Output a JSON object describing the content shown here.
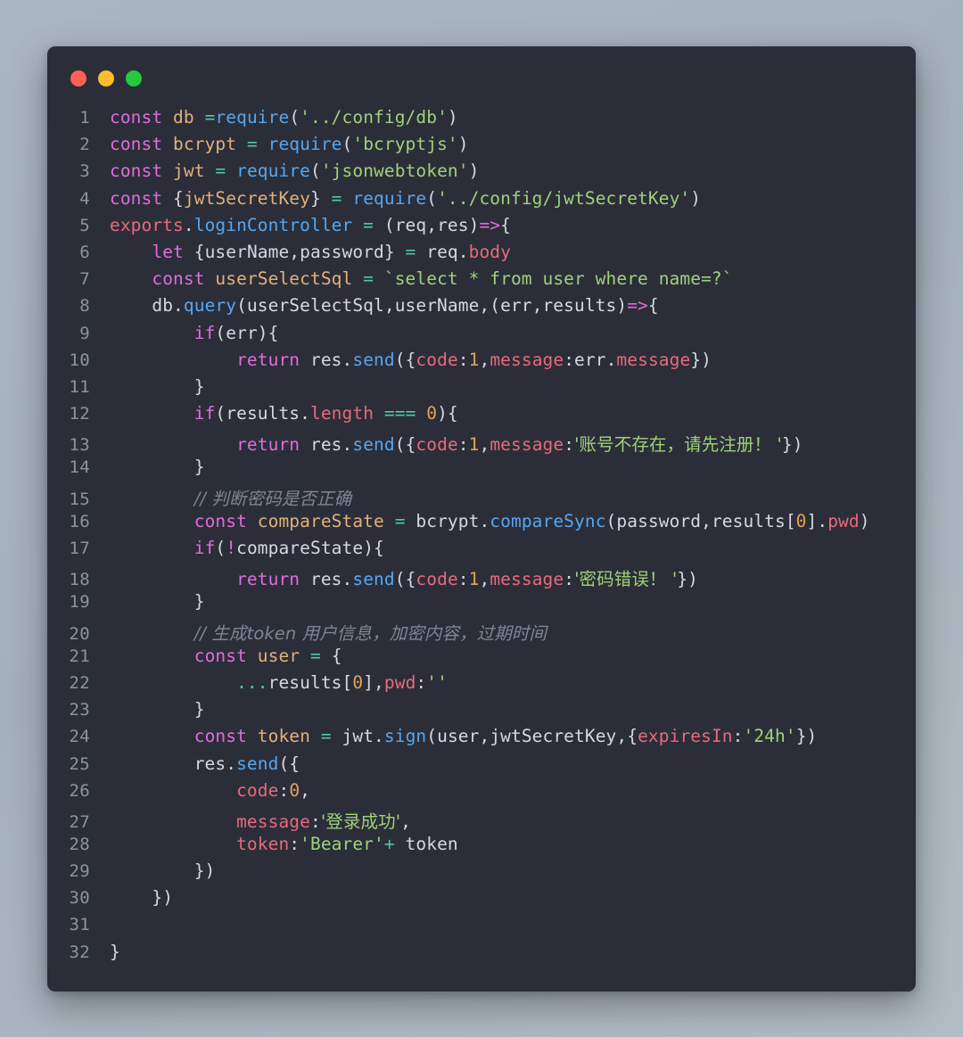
{
  "window": {
    "controls": [
      {
        "name": "close",
        "color": "#ff5f56"
      },
      {
        "name": "minimize",
        "color": "#ffbd2e"
      },
      {
        "name": "maximize",
        "color": "#27c93f"
      }
    ],
    "background_color": "#2b2e38",
    "page_background_color": "#a8b4bf"
  },
  "editor": {
    "language": "javascript",
    "first_line_number": 1,
    "last_line_number": 32,
    "theme_colors": {
      "keyword": "#e06cdc",
      "function": "#57a6f0",
      "variable": "#e2b07a",
      "string": "#9fd17a",
      "number": "#e2a355",
      "operator": "#4ec9b0",
      "property": "#e86a7c",
      "plain": "#d5d8de",
      "comment": "#7f8595",
      "line_number": "#8d93a3"
    },
    "lines": [
      {
        "n": "1",
        "text": "const db =require('../config/db')"
      },
      {
        "n": "2",
        "text": "const bcrypt = require('bcryptjs')"
      },
      {
        "n": "3",
        "text": "const jwt = require('jsonwebtoken')"
      },
      {
        "n": "4",
        "text": "const {jwtSecretKey} = require('../config/jwtSecretKey')"
      },
      {
        "n": "5",
        "text": "exports.loginController = (req,res)=>{"
      },
      {
        "n": "6",
        "text": "    let {userName,password} = req.body"
      },
      {
        "n": "7",
        "text": "    const userSelectSql = `select * from user where name=?`"
      },
      {
        "n": "8",
        "text": "    db.query(userSelectSql,userName,(err,results)=>{"
      },
      {
        "n": "9",
        "text": "        if(err){"
      },
      {
        "n": "10",
        "text": "            return res.send({code:1,message:err.message})"
      },
      {
        "n": "11",
        "text": "        }"
      },
      {
        "n": "12",
        "text": "        if(results.length === 0){"
      },
      {
        "n": "13",
        "text": "            return res.send({code:1,message:'账号不存在，请先注册！ '})"
      },
      {
        "n": "14",
        "text": "        }"
      },
      {
        "n": "15",
        "text": "        // 判断密码是否正确"
      },
      {
        "n": "16",
        "text": "        const compareState = bcrypt.compareSync(password,results[0].pwd)"
      },
      {
        "n": "17",
        "text": "        if(!compareState){"
      },
      {
        "n": "18",
        "text": "            return res.send({code:1,message:'密码错误！ '})"
      },
      {
        "n": "19",
        "text": "        }"
      },
      {
        "n": "20",
        "text": "        // 生成token 用户信息，加密内容，过期时间"
      },
      {
        "n": "21",
        "text": "        const user = {"
      },
      {
        "n": "22",
        "text": "            ...results[0],pwd:''"
      },
      {
        "n": "23",
        "text": "        }"
      },
      {
        "n": "24",
        "text": "        const token = jwt.sign(user,jwtSecretKey,{expiresIn:'24h'})"
      },
      {
        "n": "25",
        "text": "        res.send({"
      },
      {
        "n": "26",
        "text": "            code:0,"
      },
      {
        "n": "27",
        "text": "            message:'登录成功',"
      },
      {
        "n": "28",
        "text": "            token:'Bearer'+ token"
      },
      {
        "n": "29",
        "text": "        })"
      },
      {
        "n": "30",
        "text": "    })"
      },
      {
        "n": "31",
        "text": ""
      },
      {
        "n": "32",
        "text": "}"
      }
    ],
    "tokens": [
      [
        {
          "t": "const",
          "c": "kw"
        },
        {
          "t": " ",
          "c": "plain"
        },
        {
          "t": "db",
          "c": "var"
        },
        {
          "t": " =",
          "c": "op"
        },
        {
          "t": "require",
          "c": "fn"
        },
        {
          "t": "(",
          "c": "plain"
        },
        {
          "t": "'../config/db'",
          "c": "str"
        },
        {
          "t": ")",
          "c": "plain"
        }
      ],
      [
        {
          "t": "const",
          "c": "kw"
        },
        {
          "t": " ",
          "c": "plain"
        },
        {
          "t": "bcrypt",
          "c": "var"
        },
        {
          "t": " = ",
          "c": "op"
        },
        {
          "t": "require",
          "c": "fn"
        },
        {
          "t": "(",
          "c": "plain"
        },
        {
          "t": "'bcryptjs'",
          "c": "str"
        },
        {
          "t": ")",
          "c": "plain"
        }
      ],
      [
        {
          "t": "const",
          "c": "kw"
        },
        {
          "t": " ",
          "c": "plain"
        },
        {
          "t": "jwt",
          "c": "var"
        },
        {
          "t": " = ",
          "c": "op"
        },
        {
          "t": "require",
          "c": "fn"
        },
        {
          "t": "(",
          "c": "plain"
        },
        {
          "t": "'jsonwebtoken'",
          "c": "str"
        },
        {
          "t": ")",
          "c": "plain"
        }
      ],
      [
        {
          "t": "const",
          "c": "kw"
        },
        {
          "t": " {",
          "c": "plain"
        },
        {
          "t": "jwtSecretKey",
          "c": "var"
        },
        {
          "t": "} ",
          "c": "plain"
        },
        {
          "t": "= ",
          "c": "op"
        },
        {
          "t": "require",
          "c": "fn"
        },
        {
          "t": "(",
          "c": "plain"
        },
        {
          "t": "'../config/jwtSecretKey'",
          "c": "str"
        },
        {
          "t": ")",
          "c": "plain"
        }
      ],
      [
        {
          "t": "exports",
          "c": "prop"
        },
        {
          "t": ".",
          "c": "plain"
        },
        {
          "t": "loginController",
          "c": "fn"
        },
        {
          "t": " = ",
          "c": "op"
        },
        {
          "t": "(req,res)",
          "c": "plain"
        },
        {
          "t": "=>",
          "c": "kw"
        },
        {
          "t": "{",
          "c": "plain"
        }
      ],
      [
        {
          "t": "    ",
          "c": "plain"
        },
        {
          "t": "let",
          "c": "kw"
        },
        {
          "t": " {userName,password} ",
          "c": "plain"
        },
        {
          "t": "= ",
          "c": "op"
        },
        {
          "t": "req",
          "c": "plain"
        },
        {
          "t": ".",
          "c": "plain"
        },
        {
          "t": "body",
          "c": "prop"
        }
      ],
      [
        {
          "t": "    ",
          "c": "plain"
        },
        {
          "t": "const",
          "c": "kw"
        },
        {
          "t": " ",
          "c": "plain"
        },
        {
          "t": "userSelectSql",
          "c": "var"
        },
        {
          "t": " = ",
          "c": "op"
        },
        {
          "t": "`select * from user where name=?`",
          "c": "str"
        }
      ],
      [
        {
          "t": "    db",
          "c": "plain"
        },
        {
          "t": ".",
          "c": "plain"
        },
        {
          "t": "query",
          "c": "fn"
        },
        {
          "t": "(userSelectSql,userName,(err,results)",
          "c": "plain"
        },
        {
          "t": "=>",
          "c": "kw"
        },
        {
          "t": "{",
          "c": "plain"
        }
      ],
      [
        {
          "t": "        ",
          "c": "plain"
        },
        {
          "t": "if",
          "c": "kw"
        },
        {
          "t": "(err){",
          "c": "plain"
        }
      ],
      [
        {
          "t": "            ",
          "c": "plain"
        },
        {
          "t": "return",
          "c": "kw"
        },
        {
          "t": " res",
          "c": "plain"
        },
        {
          "t": ".",
          "c": "plain"
        },
        {
          "t": "send",
          "c": "fn"
        },
        {
          "t": "({",
          "c": "plain"
        },
        {
          "t": "code",
          "c": "prop"
        },
        {
          "t": ":",
          "c": "plain"
        },
        {
          "t": "1",
          "c": "num"
        },
        {
          "t": ",",
          "c": "plain"
        },
        {
          "t": "message",
          "c": "prop"
        },
        {
          "t": ":err.",
          "c": "plain"
        },
        {
          "t": "message",
          "c": "prop"
        },
        {
          "t": "})",
          "c": "plain"
        }
      ],
      [
        {
          "t": "        }",
          "c": "plain"
        }
      ],
      [
        {
          "t": "        ",
          "c": "plain"
        },
        {
          "t": "if",
          "c": "kw"
        },
        {
          "t": "(results",
          "c": "plain"
        },
        {
          "t": ".",
          "c": "plain"
        },
        {
          "t": "length",
          "c": "prop"
        },
        {
          "t": " === ",
          "c": "op"
        },
        {
          "t": "0",
          "c": "num"
        },
        {
          "t": "){",
          "c": "plain"
        }
      ],
      [
        {
          "t": "            ",
          "c": "plain"
        },
        {
          "t": "return",
          "c": "kw"
        },
        {
          "t": " res",
          "c": "plain"
        },
        {
          "t": ".",
          "c": "plain"
        },
        {
          "t": "send",
          "c": "fn"
        },
        {
          "t": "({",
          "c": "plain"
        },
        {
          "t": "code",
          "c": "prop"
        },
        {
          "t": ":",
          "c": "plain"
        },
        {
          "t": "1",
          "c": "num"
        },
        {
          "t": ",",
          "c": "plain"
        },
        {
          "t": "message",
          "c": "prop"
        },
        {
          "t": ":",
          "c": "plain"
        },
        {
          "t": "'账号不存在，请先注册！ '",
          "c": "str"
        },
        {
          "t": "})",
          "c": "plain"
        }
      ],
      [
        {
          "t": "        }",
          "c": "plain"
        }
      ],
      [
        {
          "t": "        ",
          "c": "plain"
        },
        {
          "t": "// 判断密码是否正确",
          "c": "comment"
        }
      ],
      [
        {
          "t": "        ",
          "c": "plain"
        },
        {
          "t": "const",
          "c": "kw"
        },
        {
          "t": " ",
          "c": "plain"
        },
        {
          "t": "compareState",
          "c": "var"
        },
        {
          "t": " = ",
          "c": "op"
        },
        {
          "t": "bcrypt",
          "c": "plain"
        },
        {
          "t": ".",
          "c": "plain"
        },
        {
          "t": "compareSync",
          "c": "fn"
        },
        {
          "t": "(password,results[",
          "c": "plain"
        },
        {
          "t": "0",
          "c": "num"
        },
        {
          "t": "].",
          "c": "plain"
        },
        {
          "t": "pwd",
          "c": "prop"
        },
        {
          "t": ")",
          "c": "plain"
        }
      ],
      [
        {
          "t": "        ",
          "c": "plain"
        },
        {
          "t": "if",
          "c": "kw"
        },
        {
          "t": "(",
          "c": "plain"
        },
        {
          "t": "!",
          "c": "kw"
        },
        {
          "t": "compareState){",
          "c": "plain"
        }
      ],
      [
        {
          "t": "            ",
          "c": "plain"
        },
        {
          "t": "return",
          "c": "kw"
        },
        {
          "t": " res",
          "c": "plain"
        },
        {
          "t": ".",
          "c": "plain"
        },
        {
          "t": "send",
          "c": "fn"
        },
        {
          "t": "({",
          "c": "plain"
        },
        {
          "t": "code",
          "c": "prop"
        },
        {
          "t": ":",
          "c": "plain"
        },
        {
          "t": "1",
          "c": "num"
        },
        {
          "t": ",",
          "c": "plain"
        },
        {
          "t": "message",
          "c": "prop"
        },
        {
          "t": ":",
          "c": "plain"
        },
        {
          "t": "'密码错误！ '",
          "c": "str"
        },
        {
          "t": "})",
          "c": "plain"
        }
      ],
      [
        {
          "t": "        }",
          "c": "plain"
        }
      ],
      [
        {
          "t": "        ",
          "c": "plain"
        },
        {
          "t": "// 生成token 用户信息，加密内容，过期时间",
          "c": "comment"
        }
      ],
      [
        {
          "t": "        ",
          "c": "plain"
        },
        {
          "t": "const",
          "c": "kw"
        },
        {
          "t": " ",
          "c": "plain"
        },
        {
          "t": "user",
          "c": "var"
        },
        {
          "t": " = ",
          "c": "op"
        },
        {
          "t": "{",
          "c": "plain"
        }
      ],
      [
        {
          "t": "            ",
          "c": "plain"
        },
        {
          "t": "...",
          "c": "op"
        },
        {
          "t": "results[",
          "c": "plain"
        },
        {
          "t": "0",
          "c": "num"
        },
        {
          "t": "],",
          "c": "plain"
        },
        {
          "t": "pwd",
          "c": "prop"
        },
        {
          "t": ":",
          "c": "plain"
        },
        {
          "t": "''",
          "c": "str"
        }
      ],
      [
        {
          "t": "        }",
          "c": "plain"
        }
      ],
      [
        {
          "t": "        ",
          "c": "plain"
        },
        {
          "t": "const",
          "c": "kw"
        },
        {
          "t": " ",
          "c": "plain"
        },
        {
          "t": "token",
          "c": "var"
        },
        {
          "t": " = ",
          "c": "op"
        },
        {
          "t": "jwt",
          "c": "plain"
        },
        {
          "t": ".",
          "c": "plain"
        },
        {
          "t": "sign",
          "c": "fn"
        },
        {
          "t": "(user,jwtSecretKey,{",
          "c": "plain"
        },
        {
          "t": "expiresIn",
          "c": "prop"
        },
        {
          "t": ":",
          "c": "plain"
        },
        {
          "t": "'24h'",
          "c": "str"
        },
        {
          "t": "})",
          "c": "plain"
        }
      ],
      [
        {
          "t": "        res",
          "c": "plain"
        },
        {
          "t": ".",
          "c": "plain"
        },
        {
          "t": "send",
          "c": "fn"
        },
        {
          "t": "({",
          "c": "plain"
        }
      ],
      [
        {
          "t": "            ",
          "c": "plain"
        },
        {
          "t": "code",
          "c": "prop"
        },
        {
          "t": ":",
          "c": "plain"
        },
        {
          "t": "0",
          "c": "num"
        },
        {
          "t": ",",
          "c": "plain"
        }
      ],
      [
        {
          "t": "            ",
          "c": "plain"
        },
        {
          "t": "message",
          "c": "prop"
        },
        {
          "t": ":",
          "c": "plain"
        },
        {
          "t": "'登录成功'",
          "c": "str"
        },
        {
          "t": ",",
          "c": "plain"
        }
      ],
      [
        {
          "t": "            ",
          "c": "plain"
        },
        {
          "t": "token",
          "c": "prop"
        },
        {
          "t": ":",
          "c": "plain"
        },
        {
          "t": "'Bearer'",
          "c": "str"
        },
        {
          "t": "+",
          "c": "op"
        },
        {
          "t": " token",
          "c": "plain"
        }
      ],
      [
        {
          "t": "        })",
          "c": "plain"
        }
      ],
      [
        {
          "t": "    })",
          "c": "plain"
        }
      ],
      [
        {
          "t": "",
          "c": "plain"
        }
      ],
      [
        {
          "t": "}",
          "c": "plain"
        }
      ]
    ]
  }
}
